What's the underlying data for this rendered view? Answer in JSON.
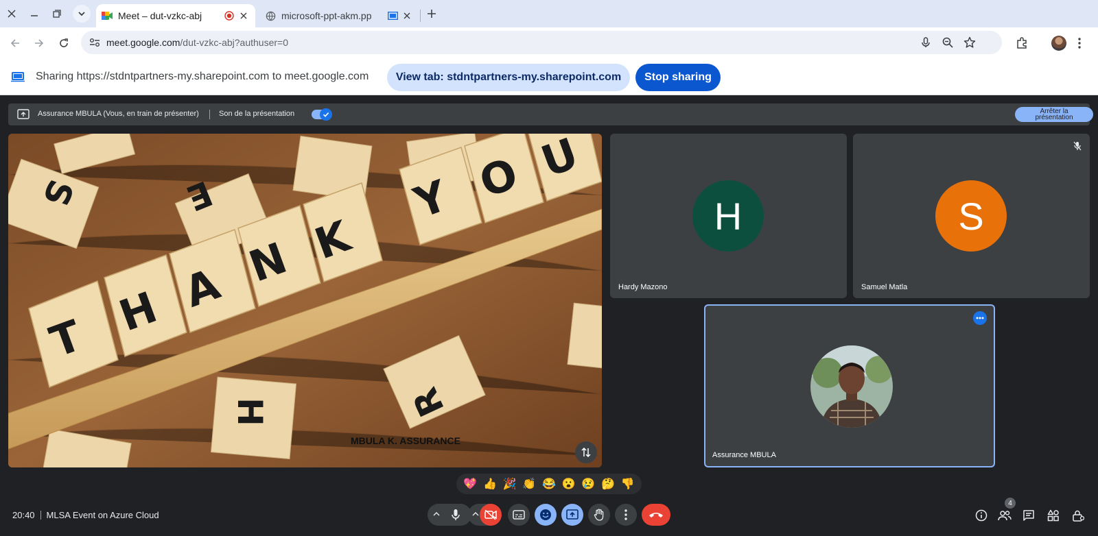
{
  "browser": {
    "tabs": [
      {
        "title": "Meet – dut-vzkc-abj",
        "active": true,
        "recording": true
      },
      {
        "title": "microsoft-ppt-akm.pp",
        "active": false,
        "sharing": true
      }
    ],
    "url_host": "meet.google.com",
    "url_path": "/dut-vzkc-abj?authuser=0"
  },
  "sharebar": {
    "text": "Sharing https://stdntpartners-my.sharepoint.com to meet.google.com",
    "view_tab_label": "View tab: stdntpartners-my.sharepoint.com",
    "stop_label": "Stop sharing"
  },
  "meet": {
    "presenting_text": "Assurance MBULA (Vous, en train de présenter)",
    "sound_label": "Son de la présentation",
    "sound_on": true,
    "stop_presenting_label_1": "Arrêter la",
    "stop_presenting_label_2": "présentation",
    "presentation_caption": "MBULA K. ASSURANCE",
    "participants": [
      {
        "name": "Hardy Mazono",
        "initial": "H",
        "color": "#0d4f3e",
        "muted": false
      },
      {
        "name": "Samuel Matla",
        "initial": "S",
        "color": "#e8710a",
        "muted": true
      },
      {
        "name": "Assurance MBULA",
        "photo": true,
        "self": true
      }
    ],
    "reactions": [
      "💖",
      "👍",
      "🎉",
      "👏",
      "😂",
      "😮",
      "😢",
      "🤔",
      "👎"
    ],
    "time": "20:40",
    "meeting_title": "MLSA Event on Azure Cloud",
    "people_count": "4"
  },
  "colors": {
    "accent": "#0b57d0",
    "meet_bg": "#202124",
    "end_call": "#ea4335"
  }
}
